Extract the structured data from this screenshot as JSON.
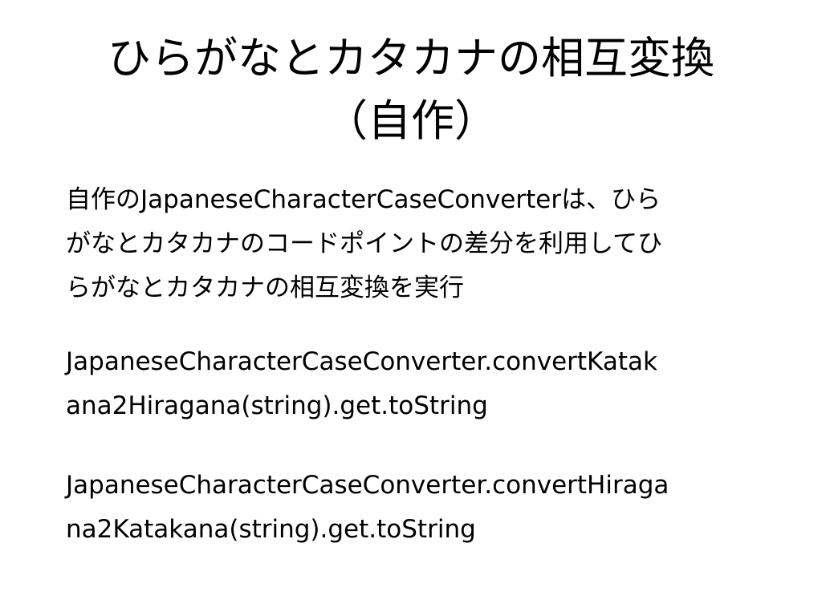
{
  "slide": {
    "title_line1": "ひらがなとカタカナの相互変換",
    "title_line2": "（自作）",
    "paragraphs": [
      {
        "lines": [
          "自作のJapaneseCharacterCaseConverterは、ひら",
          "がなとカタカナのコードポイントの差分を利用してひ",
          "らがなとカタカナの相互変換を実行"
        ]
      },
      {
        "lines": [
          "JapaneseCharacterCaseConverter.convertKatak",
          "ana2Hiragana(string).get.toString"
        ]
      },
      {
        "lines": [
          "JapaneseCharacterCaseConverter.convertHiraga",
          "na2Katakana(string).get.toString"
        ]
      }
    ]
  }
}
